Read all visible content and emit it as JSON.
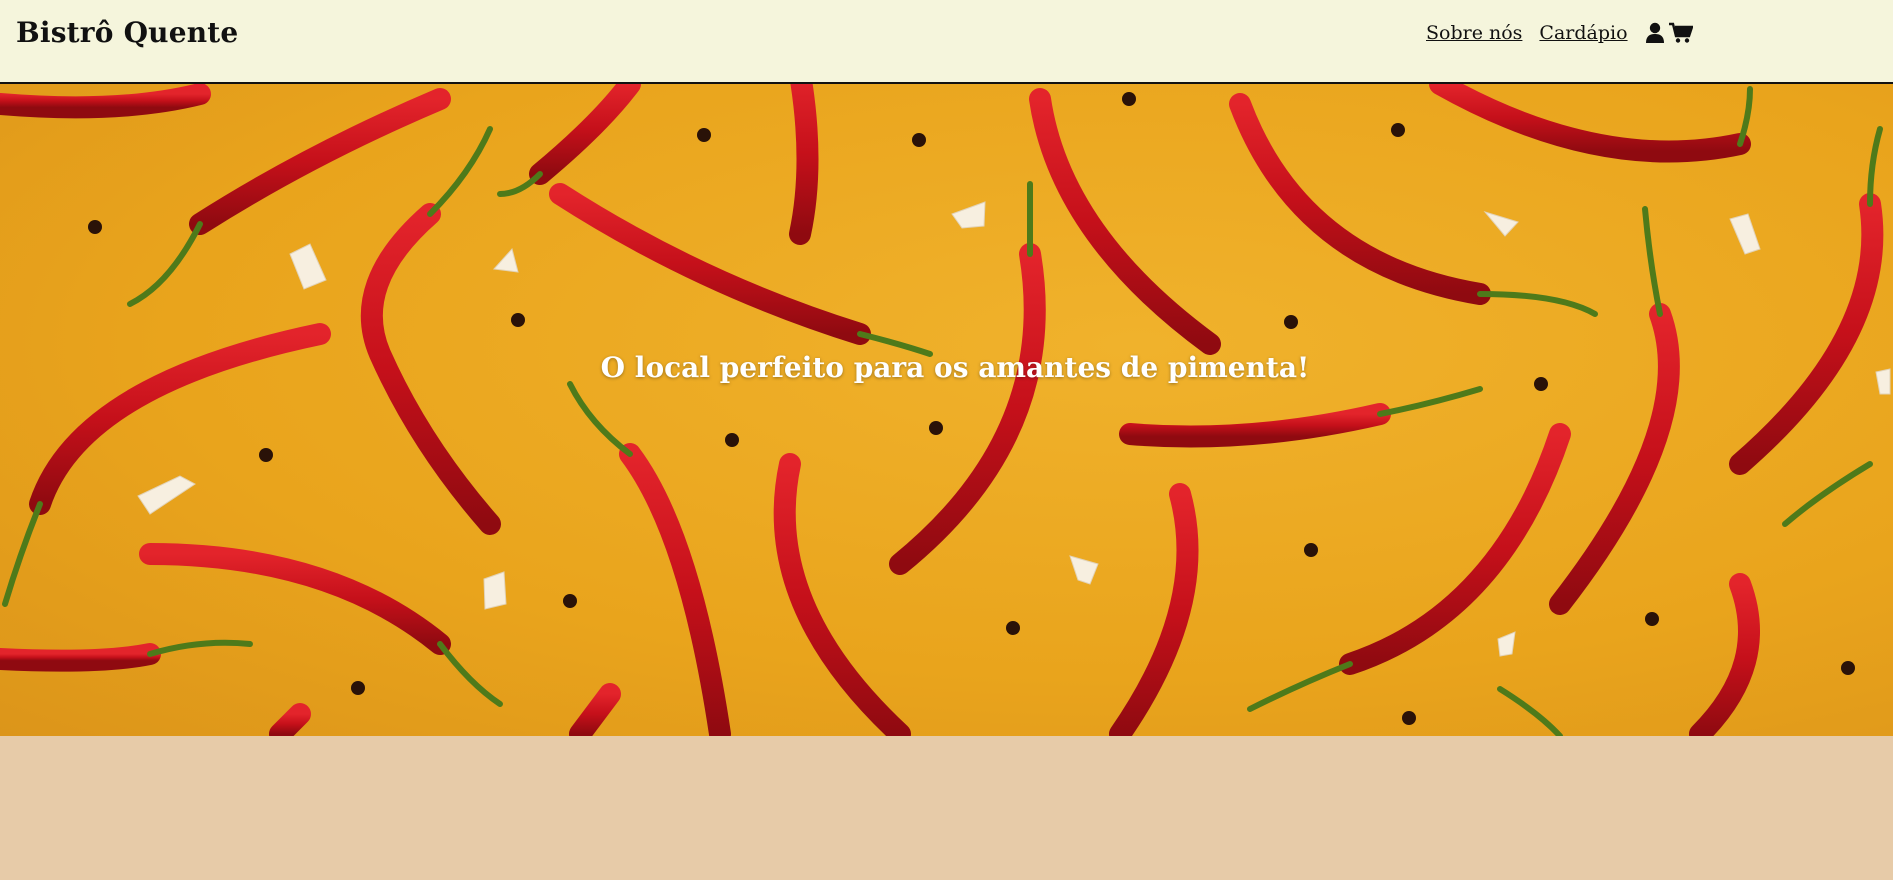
{
  "header": {
    "brand": "Bistrô Quente",
    "nav": [
      {
        "label": "Sobre nós"
      },
      {
        "label": "Cardápio"
      }
    ],
    "icons": [
      "user-icon",
      "cart-icon"
    ]
  },
  "hero": {
    "title": "O local perfeito para os amantes de pimenta!",
    "background": "photo of red chili peppers, peppercorns and garlic flakes on yellow surface"
  },
  "colors": {
    "header_bg": "#f5f5dc",
    "hero_bg": "#eca924",
    "page_bg": "#e7cba8",
    "pepper": "#c8121a"
  }
}
